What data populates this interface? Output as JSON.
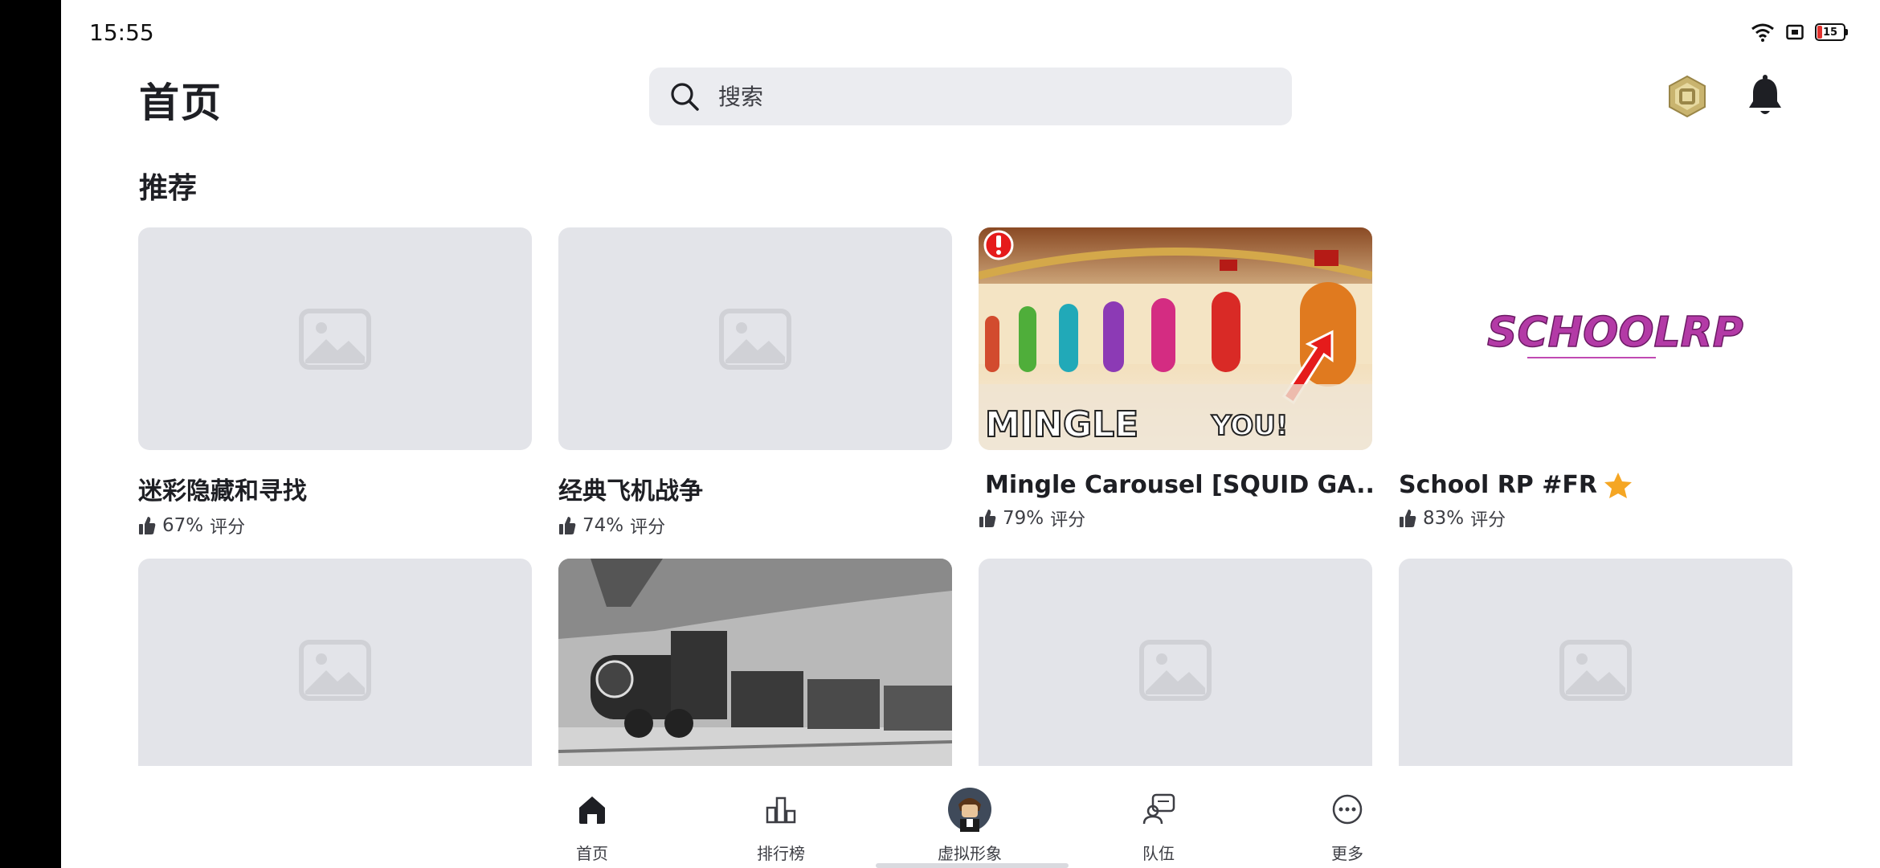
{
  "status_bar": {
    "time": "15:55",
    "battery": "15"
  },
  "header": {
    "title": "首页",
    "search_placeholder": "搜索",
    "robux_icon": "robux-icon",
    "bell_icon": "bell-icon"
  },
  "section": {
    "title": "推荐"
  },
  "games": [
    {
      "title": "迷彩隐藏和寻找",
      "rating": "67%",
      "rating_label": "评分"
    },
    {
      "title": "经典飞机战争",
      "rating": "74%",
      "rating_label": "评分"
    },
    {
      "title": "Mingle Carousel [SQUID GA...",
      "rating": "79%",
      "rating_label": "评分",
      "thumb_text_left": "MINGLE",
      "thumb_text_right": "YOU!"
    },
    {
      "title": "School RP #FR",
      "rating": "83%",
      "rating_label": "评分",
      "thumb_text": "SCHOOLRP"
    },
    {
      "title": "",
      "rating": "",
      "rating_label": ""
    },
    {
      "title": "",
      "rating": "",
      "rating_label": ""
    },
    {
      "title": "",
      "rating": "",
      "rating_label": ""
    },
    {
      "title": "",
      "rating": "",
      "rating_label": ""
    }
  ],
  "nav": [
    {
      "label": "首页",
      "icon": "home-icon"
    },
    {
      "label": "排行榜",
      "icon": "leaderboard-icon"
    },
    {
      "label": "虚拟形象",
      "icon": "avatar"
    },
    {
      "label": "队伍",
      "icon": "party-icon"
    },
    {
      "label": "更多",
      "icon": "more-icon"
    }
  ],
  "colors": {
    "background": "#ffffff",
    "placeholder": "#e3e4e9",
    "search_bg": "#ebecf0",
    "text": "#1e1f24"
  }
}
